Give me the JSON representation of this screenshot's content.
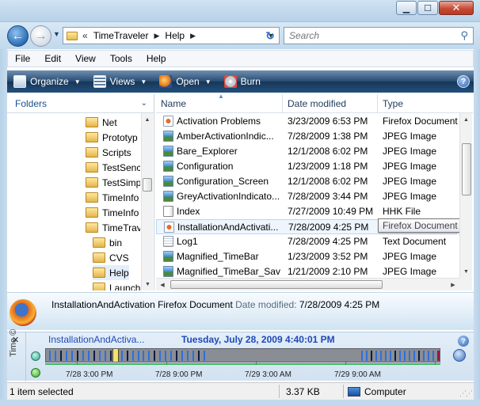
{
  "window": {
    "minimize": "▁",
    "maximize": "☐",
    "close": "✕"
  },
  "address": {
    "chevrons": "«",
    "crumbs": [
      "TimeTraveler",
      "Help"
    ],
    "search_placeholder": "Search"
  },
  "menu": [
    "File",
    "Edit",
    "View",
    "Tools",
    "Help"
  ],
  "commands": {
    "organize": "Organize",
    "views": "Views",
    "open": "Open",
    "burn": "Burn",
    "help": "?"
  },
  "nav": {
    "title": "Folders",
    "items": [
      {
        "label": "Net",
        "indent": 1
      },
      {
        "label": "Prototyp",
        "indent": 1
      },
      {
        "label": "Scripts",
        "indent": 1
      },
      {
        "label": "TestSenc",
        "indent": 1
      },
      {
        "label": "TestSimp",
        "indent": 1
      },
      {
        "label": "TimeInfo",
        "indent": 1
      },
      {
        "label": "TimeInfo",
        "indent": 1
      },
      {
        "label": "TimeTrav",
        "indent": 1
      },
      {
        "label": "bin",
        "indent": 2
      },
      {
        "label": "CVS",
        "indent": 2
      },
      {
        "label": "Help",
        "indent": 2,
        "selected": true
      },
      {
        "label": "Launch",
        "indent": 2
      }
    ]
  },
  "files": {
    "columns": [
      "Name",
      "Date modified",
      "Type"
    ],
    "rows": [
      {
        "name": "Activation Problems",
        "date": "3/23/2009 6:53 PM",
        "type": "Firefox Document",
        "icon": "html"
      },
      {
        "name": "AmberActivationIndic...",
        "date": "7/28/2009 1:38 PM",
        "type": "JPEG Image",
        "icon": "jpeg"
      },
      {
        "name": "Bare_Explorer",
        "date": "12/1/2008 6:02 PM",
        "type": "JPEG Image",
        "icon": "jpeg"
      },
      {
        "name": "Configuration",
        "date": "1/23/2009 1:18 PM",
        "type": "JPEG Image",
        "icon": "jpeg"
      },
      {
        "name": "Configuration_Screen",
        "date": "12/1/2008 6:02 PM",
        "type": "JPEG Image",
        "icon": "jpeg"
      },
      {
        "name": "GreyActivationIndicato...",
        "date": "7/28/2009 3:44 PM",
        "type": "JPEG Image",
        "icon": "jpeg"
      },
      {
        "name": "Index",
        "date": "7/27/2009 10:49 PM",
        "type": "HHK File",
        "icon": "hhk"
      },
      {
        "name": "InstallationAndActivati...",
        "date": "7/28/2009 4:25 PM",
        "type": "Firefox Document",
        "icon": "html",
        "hover": true
      },
      {
        "name": "Log1",
        "date": "7/28/2009 4:25 PM",
        "type": "Text Document",
        "icon": "txt"
      },
      {
        "name": "Magnified_TimeBar",
        "date": "1/23/2009 3:52 PM",
        "type": "JPEG Image",
        "icon": "jpeg"
      },
      {
        "name": "Magnified_TimeBar_Sav",
        "date": "1/21/2009 2:10 PM",
        "type": "JPEG Image",
        "icon": "jpeg"
      }
    ],
    "tooltip": "Firefox Document"
  },
  "details": {
    "name": "InstallationAndActivation",
    "type": "Firefox Document",
    "date_label": "Date modified:",
    "date_value": "7/28/2009 4:25 PM"
  },
  "timeline": {
    "close": "✕",
    "side_label": "Time ©",
    "title": "InstallationAndActiva...",
    "datetime": "Tuesday, July 28, 2009 4:40:01 PM",
    "help": "?",
    "labels": [
      "7/28 3:00 PM",
      "7/28 9:00 PM",
      "7/29 3:00 AM",
      "7/29 9:00 AM"
    ]
  },
  "status": {
    "selection": "1 item selected",
    "size": "3.37 KB",
    "location": "Computer"
  },
  "colors": {
    "accent": "#1f49b6",
    "command_bar": "#24507e",
    "timeline_tick": "#2f6fd8"
  }
}
